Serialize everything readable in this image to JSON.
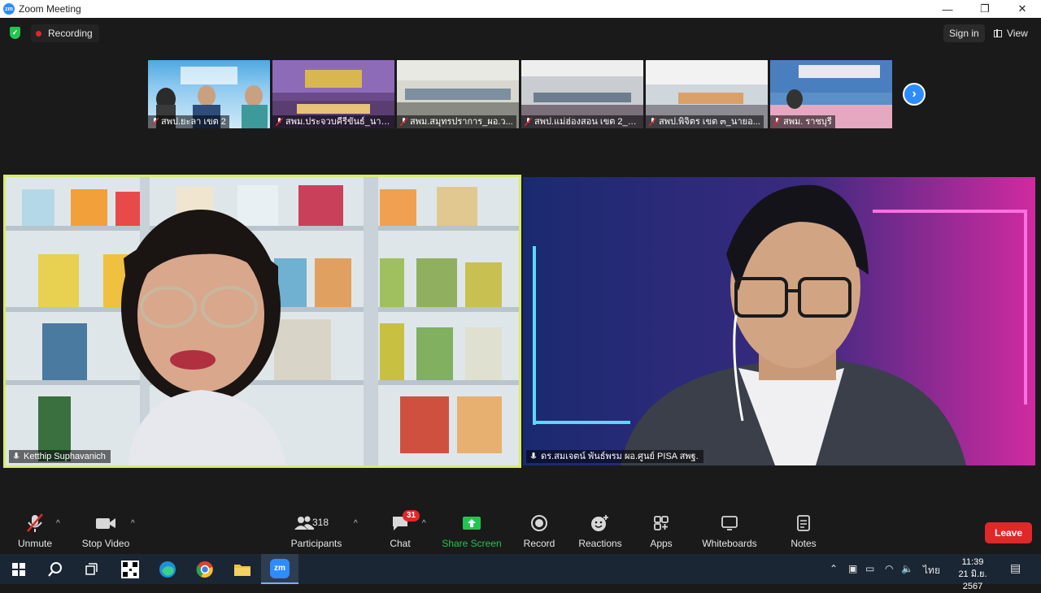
{
  "window": {
    "title": "Zoom Meeting",
    "logo_text": "zm",
    "minimize": "—",
    "maximize": "❐",
    "close": "✕"
  },
  "topbar": {
    "recording_label": "Recording",
    "signin_label": "Sign in",
    "view_label": "View"
  },
  "gallery_strip": [
    {
      "label": "สพป.ยะลา เขต 2"
    },
    {
      "label": "สพม.ประจวบคีรีขันธ์_นาย..."
    },
    {
      "label": "สพม.สมุทรปราการ_ผอ.ว..."
    },
    {
      "label": "สพป.แม่ฮ่องสอน เขต 2_น..."
    },
    {
      "label": "สพป.พิจิตร เขต ๓_นายอ..."
    },
    {
      "label": "สพม. ราชบุรี"
    }
  ],
  "main_tiles": {
    "left_name": "Ketthip Suphavanich",
    "right_name": "ดร.สมเจตน์ พันธ์พรม ผอ.ศูนย์ PISA สพฐ."
  },
  "toolbar": {
    "unmute": "Unmute",
    "stop_video": "Stop Video",
    "participants": "Participants",
    "participants_count": "318",
    "chat": "Chat",
    "chat_badge": "31",
    "share_screen": "Share Screen",
    "record": "Record",
    "reactions": "Reactions",
    "apps": "Apps",
    "whiteboards": "Whiteboards",
    "notes": "Notes",
    "leave": "Leave"
  },
  "taskbar": {
    "zoom_app_label": "zm",
    "language": "ไทย",
    "time": "11:39",
    "date": "21 มิ.ย. 2567"
  },
  "colors": {
    "accent": "#2d8cff",
    "share_green": "#23c552",
    "leave_red": "#e02828",
    "active_speaker": "#d8ec6a"
  }
}
